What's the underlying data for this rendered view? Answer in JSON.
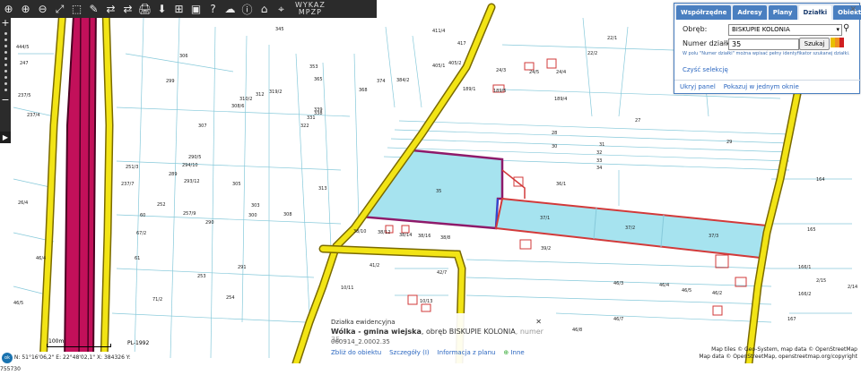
{
  "toolbar": {
    "buttons": [
      "⊕",
      "⊖",
      "⤢",
      "⬚",
      "✎",
      "⇄",
      "🖨",
      "⬇",
      "ⓘ",
      "⊞",
      "▣",
      "?",
      "☁",
      "⌂",
      "⌖"
    ],
    "brand_line1": "WYKAZ",
    "brand_line2": "MPZP"
  },
  "sidebar": {
    "zoom_in": "+",
    "zoom_out": "−",
    "play": "▶"
  },
  "panel": {
    "tabs": [
      "Współrzędne",
      "Adresy",
      "Plany",
      "Działki",
      "Obiekty"
    ],
    "active_tab": "Działki",
    "obreb_label": "Obręb:",
    "obreb_value": "BISKUPIE KOLONIA",
    "dzialka_label": "Numer działki:",
    "dzialka_value": "35",
    "search_button": "Szukaj",
    "hint": "W polu \"Numer działki\" można wpisać pełny identyfikator szukanej działki.",
    "clear_link": "Czyść selekcję",
    "hide_panel": "Ukryj panel",
    "show_one_window": "Pokazuj w jednym oknie"
  },
  "info": {
    "title": "Działka ewidencyjna",
    "place": "Wólka - gmina wiejska",
    "obreb": ", obręb BISKUPIE KOLONIA",
    "number_note": ", numer 35",
    "id": "060914_2.0002.35",
    "links": [
      "Zbliż do obiektu",
      "Szczegóły (I)",
      "Informacja z planu",
      "Inne"
    ]
  },
  "status": {
    "scale": "100m",
    "ok": "ok",
    "coords": "N: 51°16'06,2\"  E: 22°48'02,1\"  X: 384326  Y: 755730",
    "crs": "PL-1992"
  },
  "attribution": {
    "line1": "Map tiles © Geo-System, map data © OpenStreetMap",
    "line2": "Map data © OpenStreetMap, openstreetmap.org/copyright"
  },
  "parcels": [
    "345",
    "411/4",
    "417",
    "22/1",
    "22/2",
    "306",
    "24/3",
    "24/5",
    "24/4",
    "189/1",
    "189/4",
    "299",
    "353",
    "355",
    "365",
    "368",
    "376",
    "374",
    "384/2",
    "405/1",
    "405/2",
    "189/5",
    "310/2",
    "312",
    "319/2",
    "339",
    "308/6",
    "322",
    "338",
    "331",
    "307",
    "27",
    "28",
    "29",
    "30",
    "31",
    "32",
    "33",
    "34",
    "290/5",
    "294/10",
    "293/12",
    "305",
    "313",
    "251/3",
    "237/7",
    "289",
    "252",
    "257/9",
    "290",
    "303",
    "300",
    "308",
    "35",
    "36/1",
    "164",
    "37/1",
    "37/2",
    "37/3",
    "165",
    "38/10",
    "38/12",
    "38/14",
    "38/16",
    "38/8",
    "39/2",
    "166/1",
    "166/2",
    "41/2",
    "42/7",
    "46/3",
    "46/4",
    "46/5",
    "46/2",
    "46/7",
    "46/8",
    "10/11",
    "10/13",
    "166/3",
    "166/5",
    "167",
    "71/2",
    "67/2",
    "257/2",
    "59",
    "60",
    "61",
    "253",
    "254",
    "86",
    "2/15",
    "2/14"
  ],
  "colors": {
    "road": "#f2e415",
    "road_edge": "#7a6a00",
    "highway": "#c2105a",
    "selected_fill": "#a6e3ef",
    "selected_border": "#8e1a6a",
    "parcel_line": "#7fc6d8",
    "red_outline": "#d23a3a",
    "panel_tab": "#4a7fc0"
  }
}
